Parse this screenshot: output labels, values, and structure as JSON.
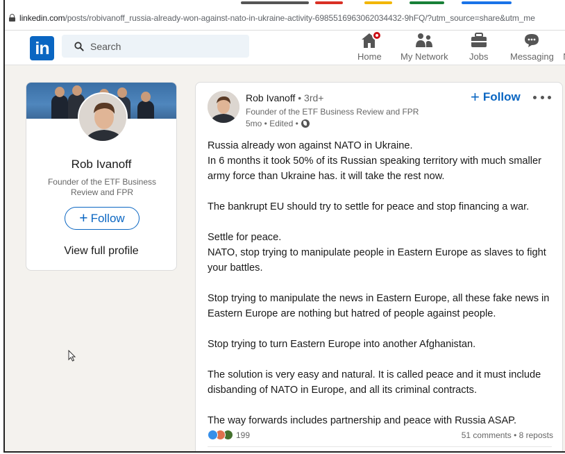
{
  "browser": {
    "url_host": "linkedin.com",
    "url_path": "/posts/robivanoff_russia-already-won-against-nato-in-ukraine-activity-6985516963062034432-9hFQ/?utm_source=share&utm_me"
  },
  "nav": {
    "logo": "in",
    "search_placeholder": "Search",
    "items": [
      {
        "label": "Home",
        "icon": "home-icon"
      },
      {
        "label": "My Network",
        "icon": "network-icon"
      },
      {
        "label": "Jobs",
        "icon": "briefcase-icon"
      },
      {
        "label": "Messaging",
        "icon": "messaging-icon"
      },
      {
        "label": "N",
        "icon": "notifications-icon"
      }
    ]
  },
  "profile_card": {
    "name": "Rob Ivanoff",
    "headline": "Founder of the ETF Business Review and FPR",
    "follow_label": "Follow",
    "view_profile_label": "View full profile"
  },
  "post": {
    "author": "Rob Ivanoff",
    "degree": "• 3rd+",
    "author_headline": "Founder of the ETF Business Review and FPR",
    "meta": "5mo • Edited •",
    "follow_label": "Follow",
    "paragraphs": [
      [
        "Russia already won against NATO in Ukraine.",
        "In 6 months it took 50% of its Russian speaking territory with much smaller army force than Ukraine has. it will take the rest now."
      ],
      [
        "The bankrupt EU should try to settle for peace and stop financing a war."
      ],
      [
        "Settle for peace.",
        "NATO, stop trying to manipulate people in Eastern Europe as slaves to fight your battles."
      ],
      [
        "Stop trying to manipulate the news in Eastern Europe, all these fake news in Eastern Europe are nothing but hatred of people against people."
      ],
      [
        "Stop trying to turn Eastern Europe into another Afghanistan."
      ],
      [
        "The solution is very easy and natural. It is called peace and it must include disbanding of NATO in Europe, and all its criminal contracts."
      ],
      [
        "The way forwards includes partnership and peace with Russia ASAP."
      ]
    ],
    "reaction_count": "199",
    "comments_reposts": "51 comments • 8 reposts"
  },
  "colors": {
    "brand": "#0a66c2",
    "page_bg": "#f4f2ee",
    "badge": "#cc1016"
  }
}
